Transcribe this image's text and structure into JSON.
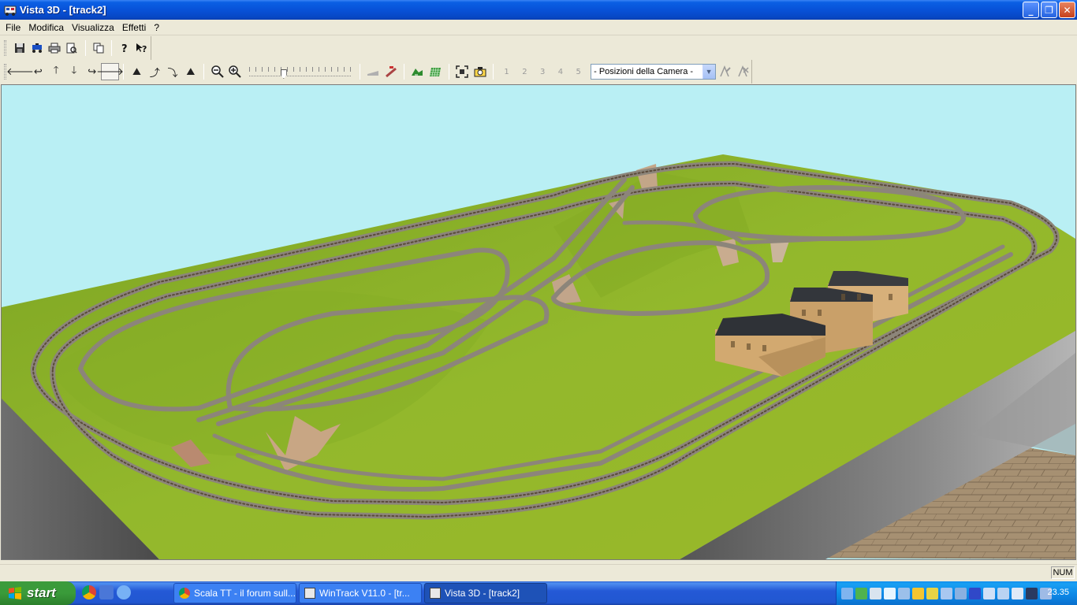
{
  "window": {
    "title": "Vista 3D - [track2]",
    "minimize": "_",
    "restore": "❐",
    "close": "✕"
  },
  "menu": [
    "File",
    "Modifica",
    "Visualizza",
    "Effetti",
    "?"
  ],
  "toolbar": {
    "camera_combo": "- Posizioni della Camera -",
    "camera_slots": [
      "1",
      "2",
      "3",
      "4",
      "5"
    ]
  },
  "statusbar": {
    "num": "NUM"
  },
  "taskbar": {
    "start": "start",
    "tasks": [
      {
        "label": "Scala TT - il forum sull...",
        "icon": "chrome-icon"
      },
      {
        "label": "WinTrack  V11.0 - [tr...",
        "icon": "wintrack-icon"
      },
      {
        "label": "Vista 3D - [track2]",
        "icon": "wintrack-icon",
        "active": true
      }
    ],
    "clock": "23.35"
  },
  "colors": {
    "sky": "#b9eff4",
    "grass": "#8fb32a",
    "track": "#8c857a",
    "building_wall": "#d7b07a",
    "roof": "#3a3c40"
  }
}
